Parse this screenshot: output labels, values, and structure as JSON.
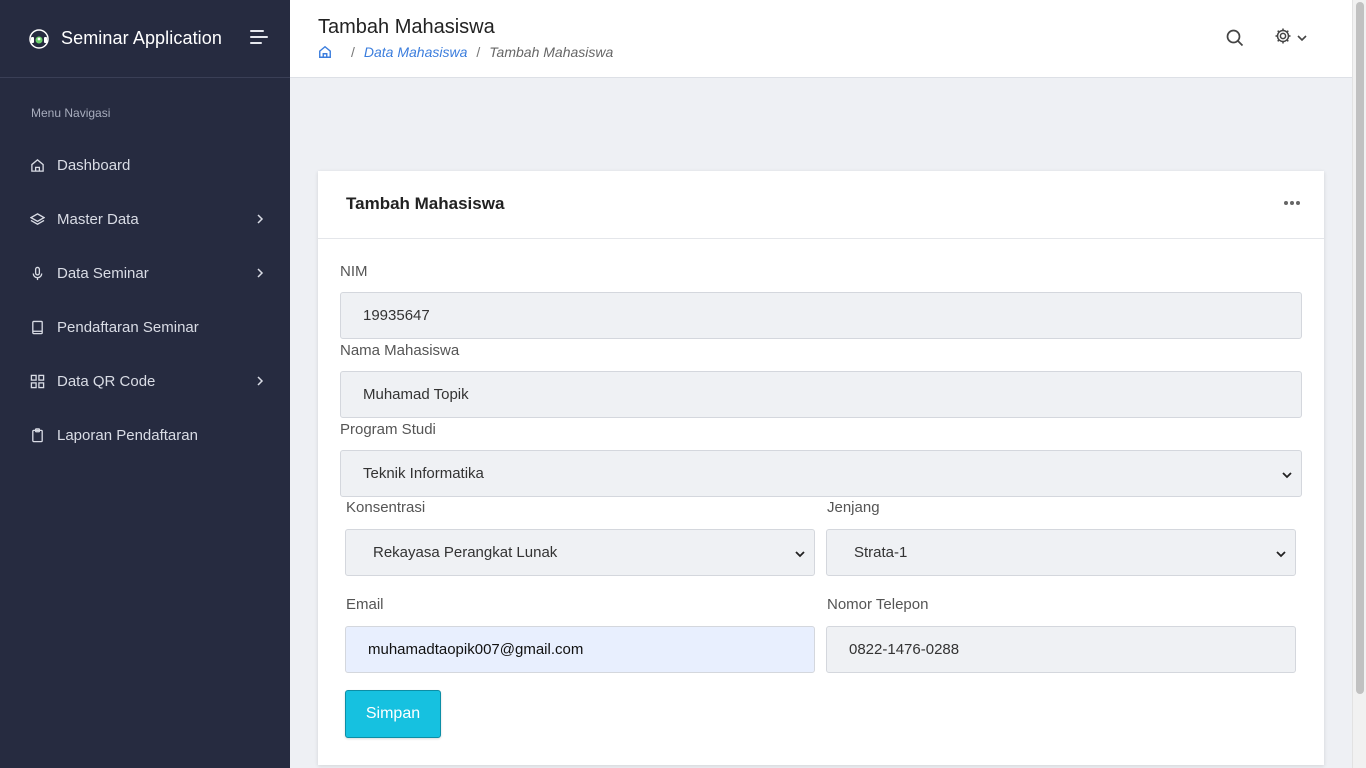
{
  "sidebar": {
    "app_title": "Seminar Application",
    "menu_caption": "Menu Navigasi",
    "items": [
      {
        "label": "Dashboard",
        "icon": "home-icon",
        "has_submenu": false
      },
      {
        "label": "Master Data",
        "icon": "layers-icon",
        "has_submenu": true
      },
      {
        "label": "Data Seminar",
        "icon": "microphone-icon",
        "has_submenu": true
      },
      {
        "label": "Pendaftaran Seminar",
        "icon": "book-icon",
        "has_submenu": false
      },
      {
        "label": "Data QR Code",
        "icon": "grid-icon",
        "has_submenu": true
      },
      {
        "label": "Laporan Pendaftaran",
        "icon": "clipboard-icon",
        "has_submenu": false
      }
    ]
  },
  "header": {
    "page_title": "Tambah Mahasiswa",
    "breadcrumb": {
      "link": "Data Mahasiswa",
      "current": "Tambah Mahasiswa",
      "separator": "/"
    }
  },
  "form": {
    "card_title": "Tambah Mahasiswa",
    "nim": {
      "label": "NIM",
      "value": "19935647"
    },
    "nama": {
      "label": "Nama Mahasiswa",
      "value": "Muhamad Topik"
    },
    "prodi": {
      "label": "Program Studi",
      "value": "Teknik Informatika"
    },
    "konsentrasi": {
      "label": "Konsentrasi",
      "value": "Rekayasa Perangkat Lunak"
    },
    "jenjang": {
      "label": "Jenjang",
      "value": "Strata-1"
    },
    "email": {
      "label": "Email",
      "value": "muhamadtaopik007@gmail.com"
    },
    "telepon": {
      "label": "Nomor Telepon",
      "value": "0822-1476-0288"
    },
    "submit_label": "Simpan"
  },
  "colors": {
    "sidebar_bg": "#262b40",
    "accent_button": "#16c1e0",
    "link": "#3b7ddd"
  }
}
